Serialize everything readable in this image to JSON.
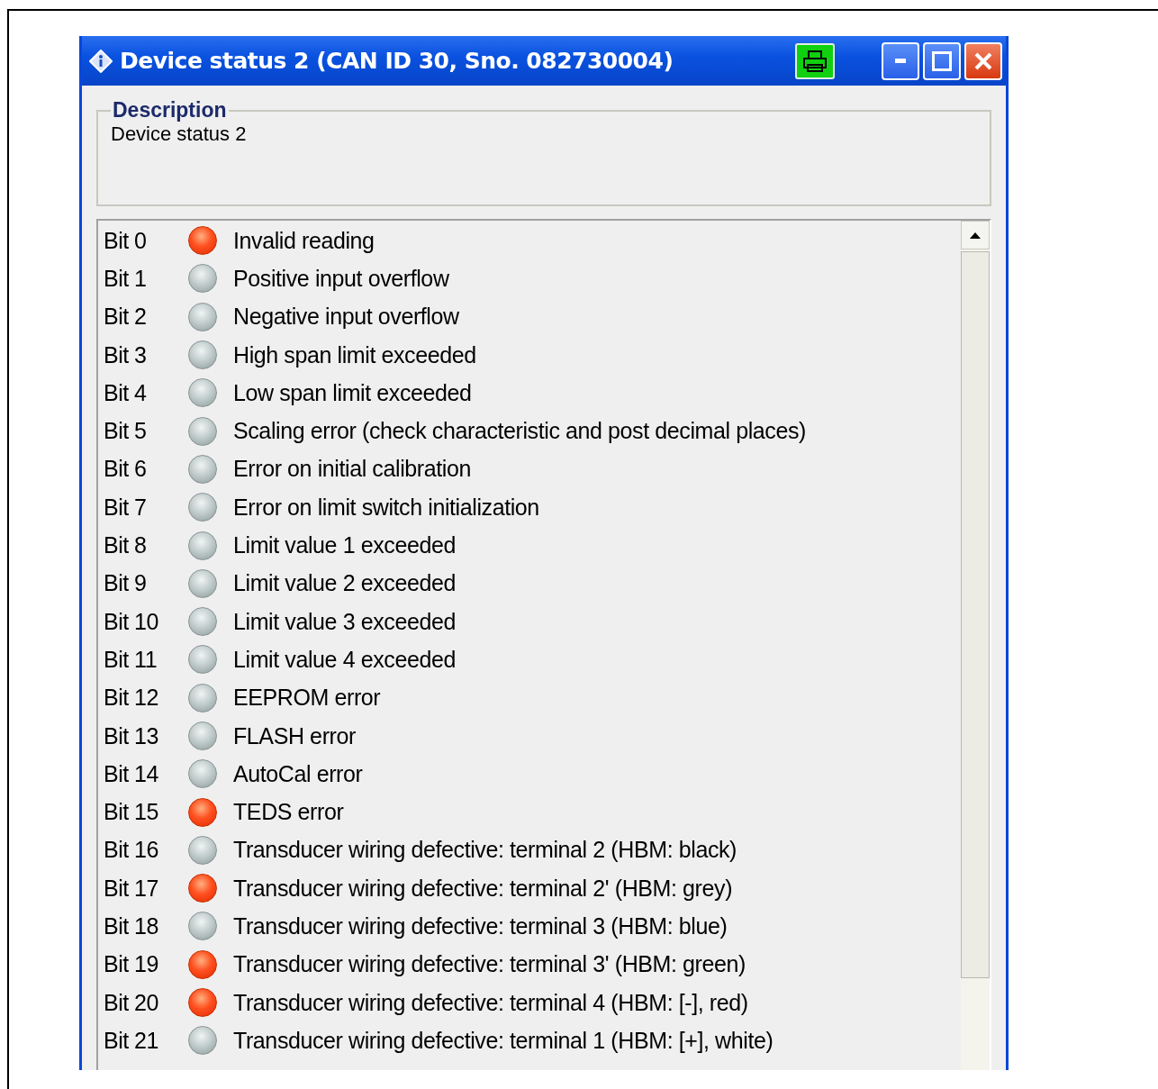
{
  "window": {
    "title": "Device status 2 (CAN ID 30, Sno. 082730004)"
  },
  "description": {
    "legend": "Description",
    "text": "Device status 2"
  },
  "bits": [
    {
      "bit": "Bit 0",
      "on": true,
      "label": "Invalid reading"
    },
    {
      "bit": "Bit 1",
      "on": false,
      "label": "Positive input overflow"
    },
    {
      "bit": "Bit 2",
      "on": false,
      "label": "Negative input overflow"
    },
    {
      "bit": "Bit 3",
      "on": false,
      "label": "High span limit exceeded"
    },
    {
      "bit": "Bit 4",
      "on": false,
      "label": "Low span limit exceeded"
    },
    {
      "bit": "Bit 5",
      "on": false,
      "label": "Scaling error (check characteristic and post decimal places)"
    },
    {
      "bit": "Bit 6",
      "on": false,
      "label": "Error on initial calibration"
    },
    {
      "bit": "Bit 7",
      "on": false,
      "label": "Error on limit switch initialization"
    },
    {
      "bit": "Bit 8",
      "on": false,
      "label": "Limit value 1 exceeded"
    },
    {
      "bit": "Bit 9",
      "on": false,
      "label": "Limit value 2 exceeded"
    },
    {
      "bit": "Bit 10",
      "on": false,
      "label": "Limit value 3 exceeded"
    },
    {
      "bit": "Bit 11",
      "on": false,
      "label": "Limit value 4 exceeded"
    },
    {
      "bit": "Bit 12",
      "on": false,
      "label": "EEPROM error"
    },
    {
      "bit": "Bit 13",
      "on": false,
      "label": "FLASH error"
    },
    {
      "bit": "Bit 14",
      "on": false,
      "label": "AutoCal error"
    },
    {
      "bit": "Bit 15",
      "on": true,
      "label": "TEDS error"
    },
    {
      "bit": "Bit 16",
      "on": false,
      "label": "Transducer wiring defective: terminal 2 (HBM: black)"
    },
    {
      "bit": "Bit 17",
      "on": true,
      "label": "Transducer wiring defective: terminal 2' (HBM: grey)"
    },
    {
      "bit": "Bit 18",
      "on": false,
      "label": "Transducer wiring defective: terminal 3 (HBM: blue)"
    },
    {
      "bit": "Bit 19",
      "on": true,
      "label": "Transducer wiring defective: terminal 3' (HBM: green)"
    },
    {
      "bit": "Bit 20",
      "on": true,
      "label": "Transducer wiring defective: terminal 4 (HBM: [-], red)"
    },
    {
      "bit": "Bit 21",
      "on": false,
      "label": "Transducer wiring defective: terminal 1 (HBM: [+], white)"
    }
  ]
}
